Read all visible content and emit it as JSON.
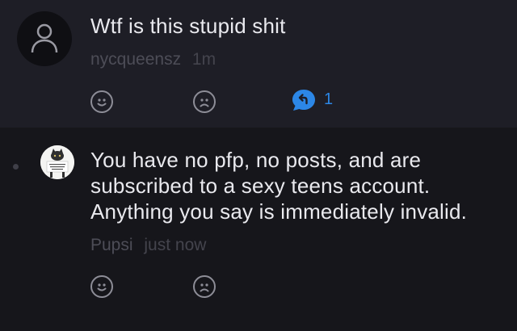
{
  "comments": [
    {
      "text": "Wtf is this stupid shit",
      "author": "nycqueensz",
      "time": "1m",
      "reply_count": "1",
      "avatar_icon": "default-user-icon"
    },
    {
      "text": "You have no pfp, no posts, and are subscribed to a sexy teens account. Anything you say is immediately invalid.",
      "author": "Pupsi",
      "time": "just now",
      "avatar_icon": "cat-photo-avatar"
    }
  ],
  "colors": {
    "accent": "#2c87e6",
    "text": "#e9e9ee",
    "meta": "#4d4d57",
    "icon": "#8d8d97"
  }
}
